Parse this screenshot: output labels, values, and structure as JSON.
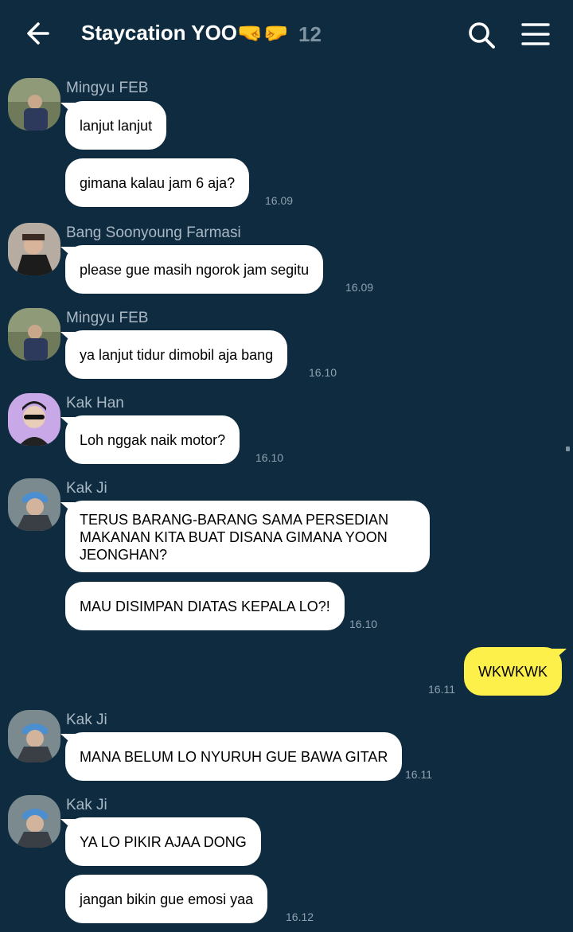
{
  "header": {
    "title": "Staycation YOO",
    "emoji": "🤜🤛",
    "member_count": "12",
    "back_icon": "arrow-left-icon",
    "search_icon": "search-icon",
    "menu_icon": "hamburger-menu-icon"
  },
  "colors": {
    "background": "#0f2b40",
    "incoming_bubble": "#ffffff",
    "outgoing_bubble": "#fef04b",
    "sender_name": "#a9b8c4",
    "timestamp": "#8fa1af"
  },
  "messages": [
    {
      "sender": "Mingyu FEB",
      "bubbles": [
        "lanjut lanjut",
        "gimana kalau jam 6 aja?"
      ],
      "time": "16.09"
    },
    {
      "sender": "Bang Soonyoung Farmasi",
      "bubbles": [
        "please gue masih ngorok jam segitu"
      ],
      "time": "16.09"
    },
    {
      "sender": "Mingyu FEB",
      "bubbles": [
        "ya lanjut tidur dimobil aja bang"
      ],
      "time": "16.10"
    },
    {
      "sender": "Kak Han",
      "bubbles": [
        "Loh nggak naik motor?"
      ],
      "time": "16.10"
    },
    {
      "sender": "Kak Ji",
      "bubbles": [
        "TERUS BARANG-BARANG SAMA PERSEDIAN MAKANAN KITA BUAT DISANA GIMANA YOON JEONGHAN?",
        "MAU DISIMPAN DIATAS KEPALA LO?!"
      ],
      "time": "16.10"
    },
    {
      "sender": "me",
      "bubbles": [
        "WKWKWK"
      ],
      "time": "16.11"
    },
    {
      "sender": "Kak Ji",
      "bubbles": [
        "MANA BELUM LO NYURUH GUE BAWA GITAR"
      ],
      "time": "16.11"
    },
    {
      "sender": "Kak Ji",
      "bubbles": [
        "YA LO PIKIR AJAA DONG",
        "jangan bikin gue emosi yaa"
      ],
      "time": "16.12"
    }
  ]
}
